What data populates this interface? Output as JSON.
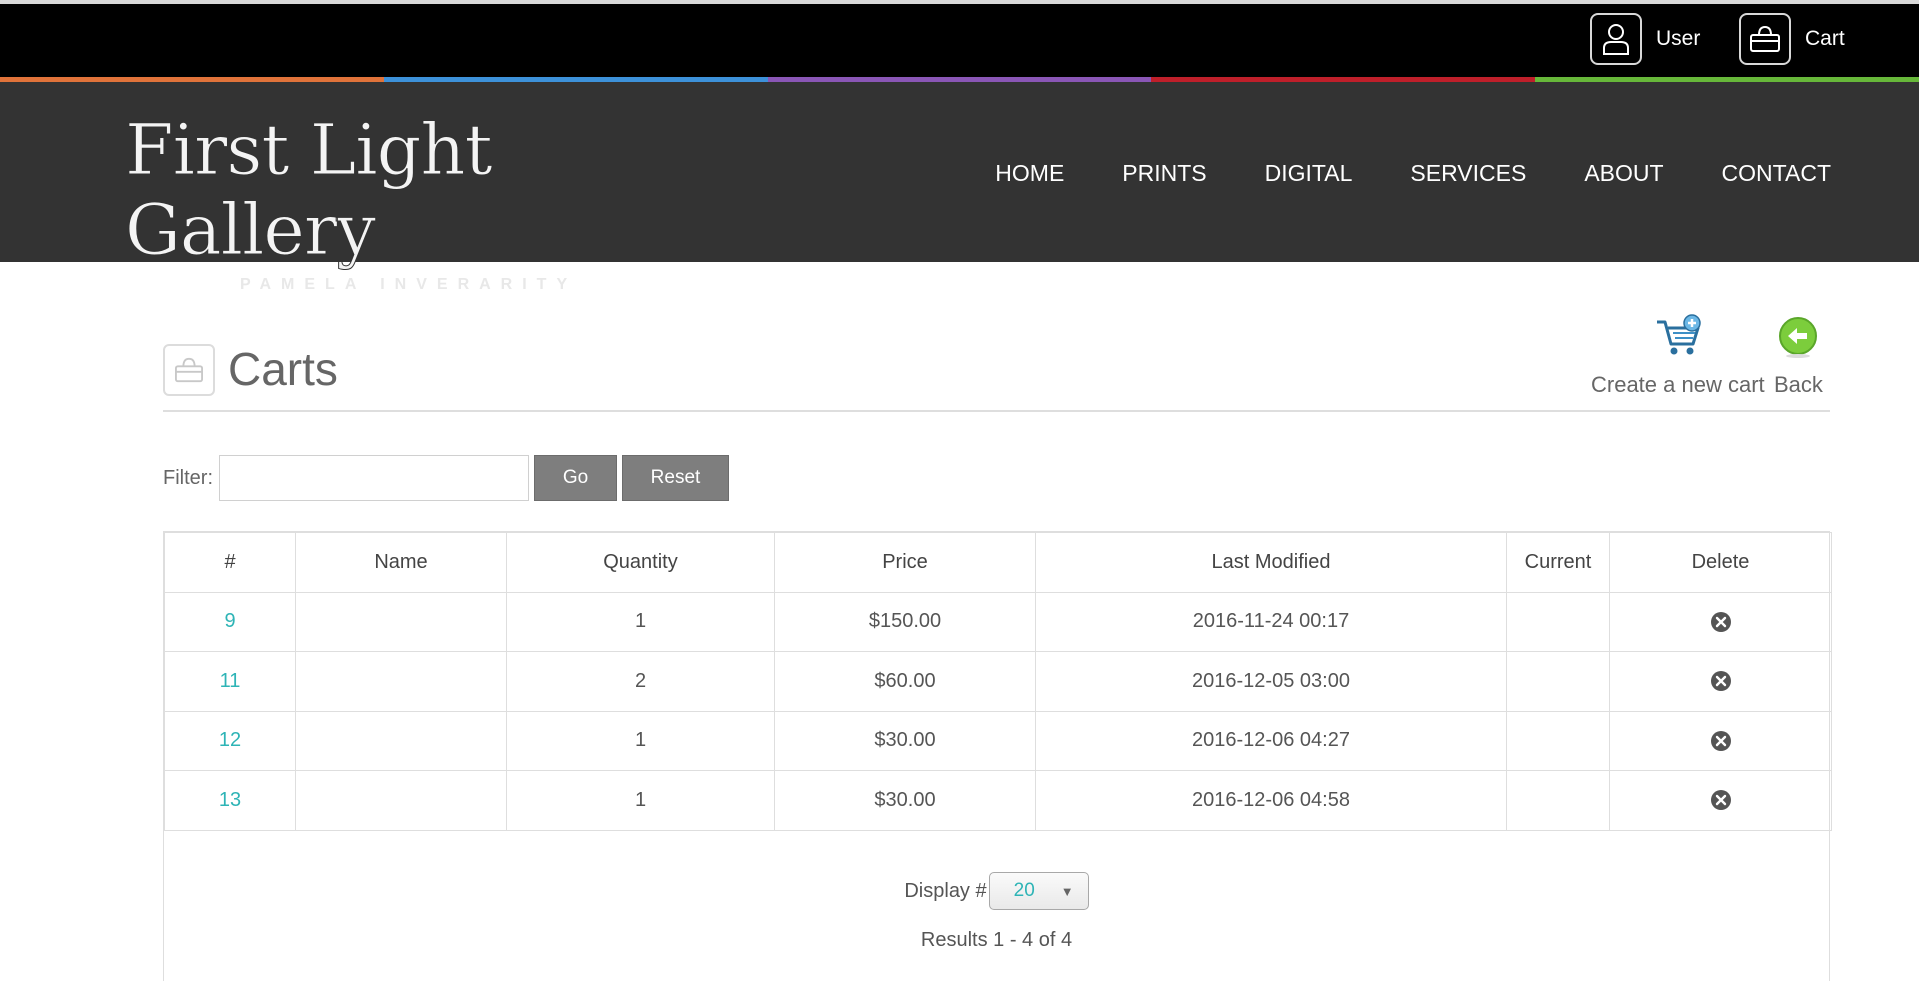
{
  "topbar": {
    "user_label": "User",
    "cart_label": "Cart"
  },
  "strip_colors": [
    "#e0733a",
    "#3d91d9",
    "#8a56b6",
    "#bf1f2a",
    "#67b83a"
  ],
  "header": {
    "logo_title": "First Light Gallery",
    "logo_subtitle": "PAMELA INVERARITY",
    "nav": [
      "HOME",
      "PRINTS",
      "DIGITAL",
      "SERVICES",
      "ABOUT",
      "CONTACT"
    ]
  },
  "page": {
    "title": "Carts",
    "actions": {
      "new_cart": "Create a new cart",
      "back": "Back"
    }
  },
  "filter": {
    "label": "Filter:",
    "value": "",
    "go": "Go",
    "reset": "Reset"
  },
  "table": {
    "columns": [
      "#",
      "Name",
      "Quantity",
      "Price",
      "Last Modified",
      "Current",
      "Delete"
    ],
    "rows": [
      {
        "id": "9",
        "name": "",
        "quantity": "1",
        "price": "$150.00",
        "modified": "2016-11-24 00:17",
        "current": ""
      },
      {
        "id": "11",
        "name": "",
        "quantity": "2",
        "price": "$60.00",
        "modified": "2016-12-05 03:00",
        "current": ""
      },
      {
        "id": "12",
        "name": "",
        "quantity": "1",
        "price": "$30.00",
        "modified": "2016-12-06 04:27",
        "current": ""
      },
      {
        "id": "13",
        "name": "",
        "quantity": "1",
        "price": "$30.00",
        "modified": "2016-12-06 04:58",
        "current": ""
      }
    ]
  },
  "pagination": {
    "display_label": "Display #",
    "display_value": "20",
    "results": "Results 1 - 4 of 4"
  },
  "colors": {
    "link": "#2eb4b6",
    "header_bg": "#333333",
    "topbar_bg": "#000000",
    "button_bg": "#7e7e7e"
  }
}
